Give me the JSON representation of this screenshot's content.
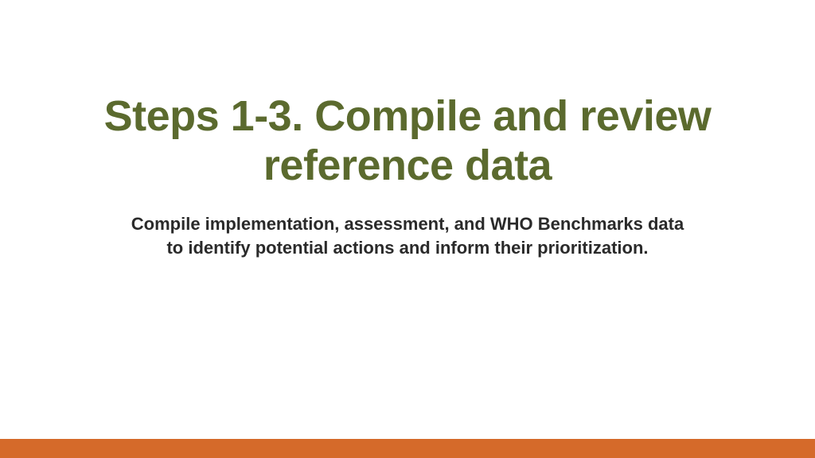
{
  "slide": {
    "title": "Steps 1-3. Compile and review reference data",
    "subtitle": "Compile implementation, assessment, and WHO Benchmarks data to identify potential actions and inform their prioritization."
  },
  "colors": {
    "title": "#5b6a2e",
    "accent_bar": "#d56a2a"
  }
}
